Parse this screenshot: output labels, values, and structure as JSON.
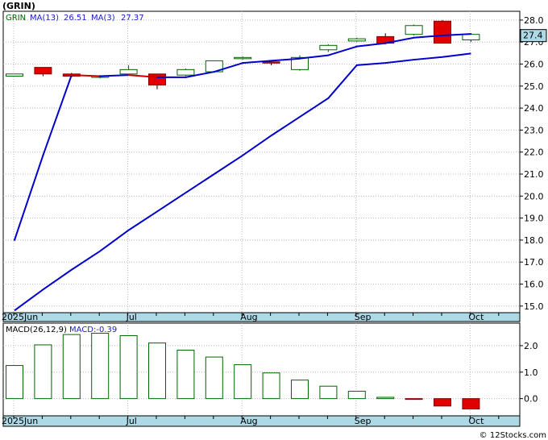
{
  "header": {
    "title": "(GRIN)",
    "legend_symbol": "GRIN",
    "ma13_label": "MA(13)",
    "ma13_value": "26.51",
    "ma3_label": "MA(3)",
    "ma3_value": "27.37",
    "last_price_tag": "27.4"
  },
  "macd_header": {
    "params_label": "MACD(26,12,9)",
    "value_label": "MACD:-0.39"
  },
  "footer": {
    "watermark": "© 12Stocks.com"
  },
  "colors": {
    "up_candle": "#006400",
    "down_candle": "#e00000",
    "ma_line": "#0000cc",
    "ma3_line": "#cc0000",
    "axis_band": "#add8e6",
    "grid": "#b8b8b8"
  },
  "chart_data": [
    {
      "type": "candlestick",
      "title": "(GRIN)",
      "ylim": [
        14.7,
        28.4
      ],
      "y_ticks": [
        "28.0",
        "27.0",
        "26.0",
        "25.0",
        "24.0",
        "23.0",
        "22.0",
        "21.0",
        "20.0",
        "19.0",
        "18.0",
        "17.0",
        "16.0",
        "15.0"
      ],
      "x_tick_labels": [
        {
          "label": "2025Jun",
          "week": 0
        },
        {
          "label": "Jul",
          "week": 4
        },
        {
          "label": "Aug",
          "week": 8
        },
        {
          "label": "Sep",
          "week": 12
        },
        {
          "label": "Oct",
          "week": 16
        }
      ],
      "candles": [
        {
          "o": 25.45,
          "c": 25.55,
          "h": 25.55,
          "l": 25.45
        },
        {
          "o": 25.85,
          "c": 25.55,
          "h": 25.85,
          "l": 25.45
        },
        {
          "o": 25.55,
          "c": 25.45,
          "h": 25.6,
          "l": 25.4
        },
        {
          "o": 25.4,
          "c": 25.45,
          "h": 25.5,
          "l": 25.35
        },
        {
          "o": 25.55,
          "c": 25.75,
          "h": 25.95,
          "l": 25.5
        },
        {
          "o": 25.55,
          "c": 25.05,
          "h": 25.55,
          "l": 24.85
        },
        {
          "o": 25.5,
          "c": 25.75,
          "h": 25.8,
          "l": 25.45
        },
        {
          "o": 25.65,
          "c": 26.15,
          "h": 26.15,
          "l": 25.6
        },
        {
          "o": 26.25,
          "c": 26.3,
          "h": 26.35,
          "l": 26.2
        },
        {
          "o": 26.1,
          "c": 26.05,
          "h": 26.15,
          "l": 25.95
        },
        {
          "o": 25.75,
          "c": 26.3,
          "h": 26.4,
          "l": 25.7
        },
        {
          "o": 26.65,
          "c": 26.85,
          "h": 26.9,
          "l": 26.55
        },
        {
          "o": 27.05,
          "c": 27.15,
          "h": 27.2,
          "l": 27.0
        },
        {
          "o": 27.25,
          "c": 26.95,
          "h": 27.4,
          "l": 26.9
        },
        {
          "o": 27.35,
          "c": 27.75,
          "h": 27.8,
          "l": 27.3
        },
        {
          "o": 27.95,
          "c": 26.95,
          "h": 28.0,
          "l": 26.95
        },
        {
          "o": 27.1,
          "c": 27.35,
          "h": 27.35,
          "l": 27.0
        }
      ],
      "series": [
        {
          "name": "MA(13)",
          "values": [
            14.8,
            15.75,
            16.65,
            17.5,
            18.45,
            19.3,
            20.15,
            21.0,
            21.85,
            22.75,
            23.6,
            24.45,
            25.95,
            26.05,
            26.2,
            26.32,
            26.48
          ]
        },
        {
          "name": "MA(3)",
          "values": [
            18.0,
            21.85,
            25.5,
            25.45,
            25.5,
            25.4,
            25.4,
            25.65,
            26.05,
            26.15,
            26.25,
            26.4,
            26.8,
            26.95,
            27.2,
            27.3,
            27.37
          ]
        }
      ]
    },
    {
      "type": "bar",
      "title": "MACD(26,12,9)",
      "ylim": [
        -0.65,
        2.85
      ],
      "y_ticks": [
        "2.0",
        "1.0",
        "0.0"
      ],
      "values": [
        1.25,
        2.03,
        2.42,
        2.47,
        2.38,
        2.1,
        1.83,
        1.57,
        1.28,
        0.97,
        0.7,
        0.47,
        0.28,
        0.05,
        -0.02,
        -0.28,
        -0.39
      ]
    }
  ]
}
